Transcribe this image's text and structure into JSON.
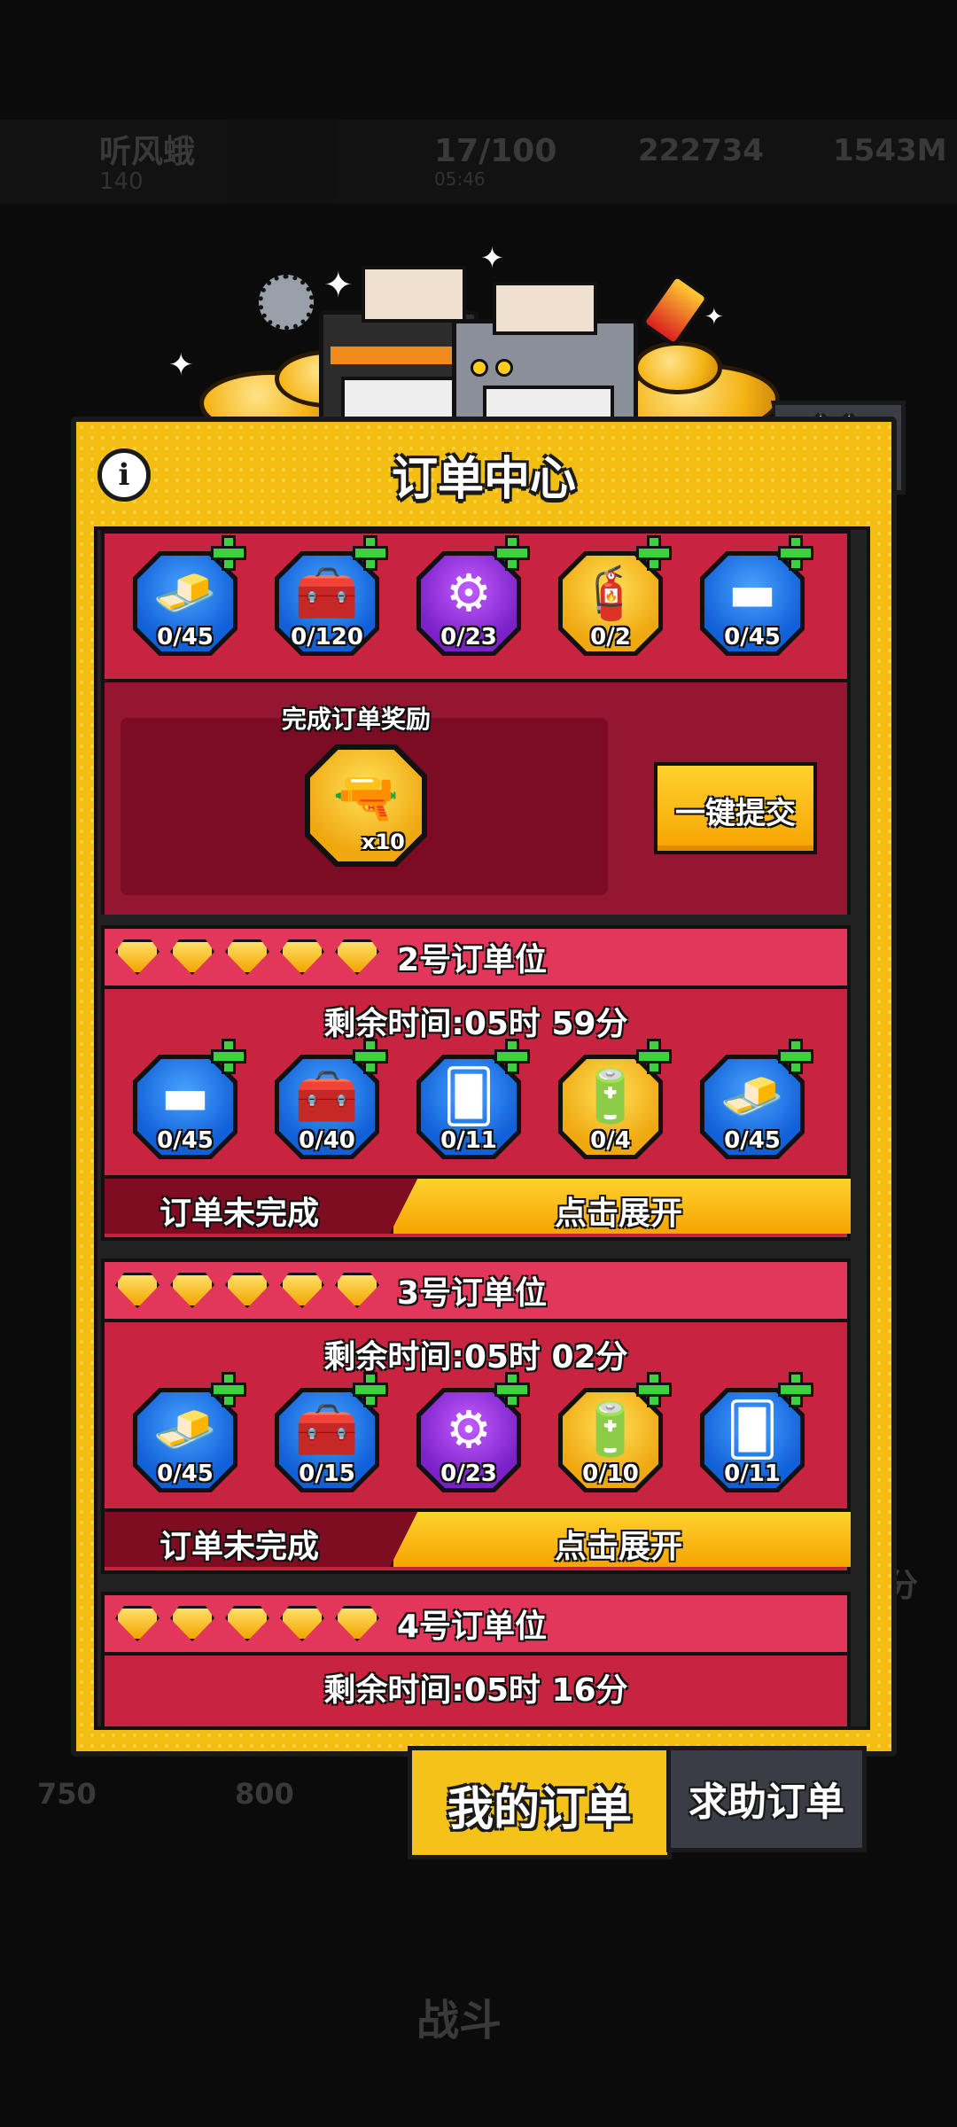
{
  "background": {
    "player_name": "听风蛾",
    "player_level": "140",
    "energy": "17/100",
    "energy_timer": "05:46",
    "gold": "222734",
    "money": "1543M",
    "price_a": "750",
    "price_b": "800",
    "side_label": "分",
    "battle_label": "战斗"
  },
  "panel": {
    "title": "订单中心",
    "info_icon": "info-icon",
    "close_icon": "close-icon"
  },
  "order1": {
    "items": [
      {
        "icon": "gold-bar-icon",
        "color": "blue",
        "count": "0/45"
      },
      {
        "icon": "first-aid-kit-icon",
        "color": "blue",
        "count": "0/120"
      },
      {
        "icon": "gear-icon",
        "color": "purple",
        "count": "0/23"
      },
      {
        "icon": "red-canister-icon",
        "color": "gold",
        "count": "0/2"
      },
      {
        "icon": "anvil-icon",
        "color": "blue",
        "count": "0/45"
      }
    ],
    "reward_label": "完成订单奖励",
    "reward_icon": "weapon-blueprint-icon",
    "reward_qty": "x10",
    "submit_label": "一键提交"
  },
  "order2": {
    "title": "2号订单位",
    "time": "剩余时间:05时 59分",
    "items": [
      {
        "icon": "anvil-icon",
        "color": "blue",
        "count": "0/45"
      },
      {
        "icon": "green-toolbox-icon",
        "color": "blue",
        "count": "0/40"
      },
      {
        "icon": "blue-card-icon",
        "color": "blue",
        "count": "0/11"
      },
      {
        "icon": "pink-battery-icon",
        "color": "gold",
        "count": "0/4"
      },
      {
        "icon": "gold-bar-icon",
        "color": "blue",
        "count": "0/45"
      }
    ],
    "status": "订单未完成",
    "expand_label": "点击展开"
  },
  "order3": {
    "title": "3号订单位",
    "time": "剩余时间:05时 02分",
    "items": [
      {
        "icon": "gold-bar-icon",
        "color": "blue",
        "count": "0/45"
      },
      {
        "icon": "green-toolbox-icon",
        "color": "blue",
        "count": "0/15"
      },
      {
        "icon": "gear-icon",
        "color": "purple",
        "count": "0/23"
      },
      {
        "icon": "pink-battery-icon",
        "color": "gold",
        "count": "0/10"
      },
      {
        "icon": "blue-card-icon",
        "color": "blue",
        "count": "0/11"
      }
    ],
    "status": "订单未完成",
    "expand_label": "点击展开"
  },
  "order4": {
    "title": "4号订单位",
    "time": "剩余时间:05时 16分"
  },
  "tabs": {
    "my_orders": "我的订单",
    "help_orders": "求助订单"
  },
  "colors": {
    "panel_yellow": "#f3bd12",
    "order_red": "#c8243f",
    "header_pink": "#e2365a",
    "dark_red": "#7f0d22",
    "plus_green": "#3cd23c"
  }
}
